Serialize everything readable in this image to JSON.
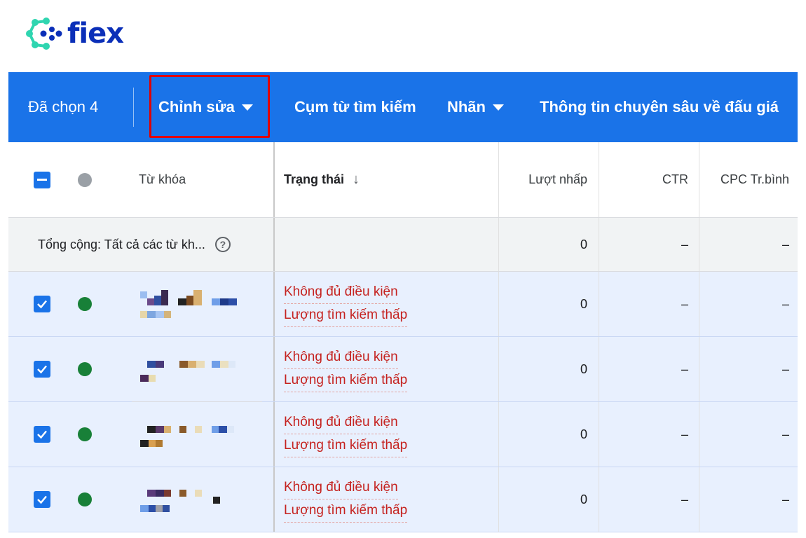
{
  "logo": {
    "text": "fiex"
  },
  "toolbar": {
    "selected_label": "Đã chọn 4",
    "edit_label": "Chỉnh sửa",
    "search_phrases_label": "Cụm từ tìm kiếm",
    "labels_label": "Nhãn",
    "auction_insights_label": "Thông tin chuyên sâu về đấu giá"
  },
  "table": {
    "headers": {
      "keyword": "Từ khóa",
      "status": "Trạng thái",
      "clicks": "Lượt nhấp",
      "ctr": "CTR",
      "avg_cpc": "CPC Tr.bình"
    },
    "total": {
      "label": "Tổng cộng: Tất cả các từ kh...",
      "clicks": "0",
      "ctr": "–",
      "avg_cpc": "–"
    },
    "rows": [
      {
        "status_1": "Không đủ điều kiện",
        "status_2": "Lượng tìm kiếm thấp",
        "clicks": "0",
        "ctr": "–",
        "avg_cpc": "–"
      },
      {
        "status_1": "Không đủ điều kiện",
        "status_2": "Lượng tìm kiếm thấp",
        "clicks": "0",
        "ctr": "–",
        "avg_cpc": "–"
      },
      {
        "status_1": "Không đủ điều kiện",
        "status_2": "Lượng tìm kiếm thấp",
        "clicks": "0",
        "ctr": "–",
        "avg_cpc": "–"
      },
      {
        "status_1": "Không đủ điều kiện",
        "status_2": "Lượng tìm kiếm thấp",
        "clicks": "0",
        "ctr": "–",
        "avg_cpc": "–"
      }
    ]
  },
  "colors": {
    "toolbar_blue": "#1a73e8",
    "highlight_red": "#e00000",
    "status_red": "#c5221f",
    "enabled_green": "#188038",
    "selected_row_bg": "#e8f0fe",
    "logo_navy": "#0b2fb8",
    "logo_teal": "#2fd5b0"
  },
  "icons": {
    "logo_mark": "fiex-molecule-logo-icon",
    "dropdown": "caret-down-icon",
    "sort": "arrow-down-icon",
    "help": "help-circle-icon",
    "checkbox_checked": "checkbox-checked-icon",
    "checkbox_partial": "checkbox-indeterminate-icon",
    "status_dot": "status-dot-icon"
  }
}
